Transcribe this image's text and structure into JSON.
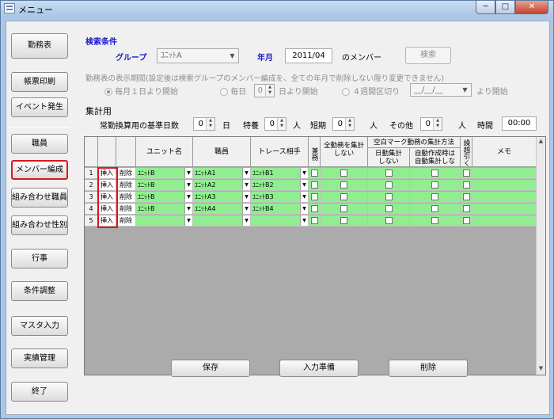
{
  "window": {
    "title": "メニュー",
    "controls": [
      "─",
      "□",
      "✕"
    ]
  },
  "sidebar": {
    "items": [
      {
        "label": "勤務表",
        "active": false
      },
      {
        "label": "帳票印刷",
        "active": false
      },
      {
        "label": "イベント発生",
        "active": false
      },
      {
        "label": "職員",
        "active": false
      },
      {
        "label": "メンバー編成",
        "active": true
      },
      {
        "label": "組み合わせ職員",
        "active": false
      },
      {
        "label": "組み合わせ性別",
        "active": false
      },
      {
        "label": "行事",
        "active": false
      },
      {
        "label": "条件調整",
        "active": false
      },
      {
        "label": "マスタ入力",
        "active": false
      },
      {
        "label": "実績管理",
        "active": false
      },
      {
        "label": "終了",
        "active": false
      }
    ]
  },
  "search": {
    "section_label": "検索条件",
    "group_label": "グループ",
    "group_value": "ﾕﾆｯﾄA",
    "yearmonth_label": "年月",
    "yearmonth_value": "2011/04",
    "member_suffix": "のメンバー",
    "search_button": "検索"
  },
  "period": {
    "heading": "勤務表の表示期間(設定後は検索グループのメンバー編成を、全ての年月で削除しない限り変更できません)",
    "opt1": "毎月１日より開始",
    "opt2_prefix": "毎日",
    "opt2_value": "0",
    "opt2_suffix": "日より開始",
    "opt3": "４週間区切り",
    "opt3_date": "__/__/__",
    "opt3_suffix": "より開始"
  },
  "aggregate": {
    "heading": "集計用",
    "base_label": "常勤換算用の基準日数",
    "base_value": "0",
    "base_unit": "日",
    "special_label": "特養",
    "special_value": "0",
    "special_unit": "人",
    "short_label": "短期",
    "short_value": "0",
    "short_unit": "人",
    "other_label": "その他",
    "other_value": "0",
    "other_unit": "人",
    "time_label": "時間",
    "time_value": "00:00"
  },
  "grid": {
    "headers": {
      "unit": "ユニット名",
      "staff": "職員",
      "trace": "トレース相手",
      "concurrent": "兼務",
      "all_shifts": "全勤務を集計しない",
      "blank_group": "空白マーク勤務の集計方法",
      "day_total": "日勤集計しない",
      "auto_total": "自動作成時は自動集計しない",
      "carry": "繰越引く",
      "memo": "メモ"
    },
    "insert_label": "挿入",
    "delete_label": "削除",
    "rows": [
      {
        "no": "1",
        "unit": "ﾕﾆｯﾄB",
        "staff": "ﾕﾆｯﾄA1",
        "trace": "ﾕﾆｯﾄB1"
      },
      {
        "no": "2",
        "unit": "ﾕﾆｯﾄB",
        "staff": "ﾕﾆｯﾄA2",
        "trace": "ﾕﾆｯﾄB2"
      },
      {
        "no": "3",
        "unit": "ﾕﾆｯﾄB",
        "staff": "ﾕﾆｯﾄA3",
        "trace": "ﾕﾆｯﾄB3"
      },
      {
        "no": "4",
        "unit": "ﾕﾆｯﾄB",
        "staff": "ﾕﾆｯﾄA4",
        "trace": "ﾕﾆｯﾄB4"
      },
      {
        "no": "5",
        "unit": "",
        "staff": "",
        "trace": ""
      }
    ]
  },
  "footer": {
    "save": "保存",
    "prepare": "入力準備",
    "delete": "削除"
  }
}
